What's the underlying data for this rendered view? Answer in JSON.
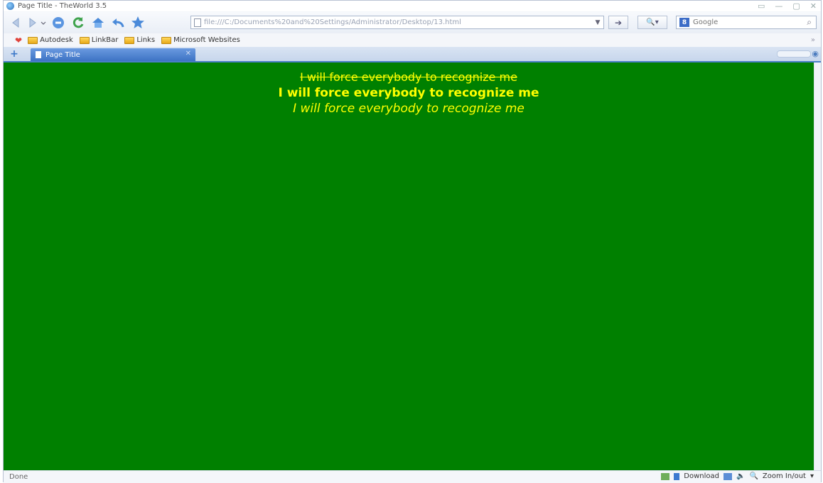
{
  "window": {
    "title": "Page Title - TheWorld 3.5",
    "controls": [
      "▭",
      "—",
      "▢",
      "✕"
    ]
  },
  "nav": {
    "address_url": "file:///C:/Documents%20and%20Settings/Administrator/Desktop/13.html",
    "search_placeholder": "Google",
    "search_engine_badge": "8"
  },
  "bookmarks": {
    "items": [
      {
        "label": "Autodesk"
      },
      {
        "label": "LinkBar"
      },
      {
        "label": "Links"
      },
      {
        "label": "Microsoft Websites"
      }
    ],
    "more": "»"
  },
  "tabs": [
    {
      "label": "Page Title",
      "active": true
    }
  ],
  "page": {
    "background": "#008000",
    "text_color": "#ffff00",
    "lines": [
      "I will force everybody to recognize me",
      "I will force everybody to recognize me",
      "I will force everybody to recognize me"
    ]
  },
  "status": {
    "text": "Done",
    "download_label": "Download",
    "zoom_label": "Zoom In/out"
  },
  "icons": {
    "back": "back-arrow-icon",
    "forward": "forward-arrow-icon",
    "stop": "stop-icon",
    "refresh": "refresh-icon",
    "home": "home-icon",
    "undo": "undo-icon",
    "favorite": "star-icon"
  }
}
